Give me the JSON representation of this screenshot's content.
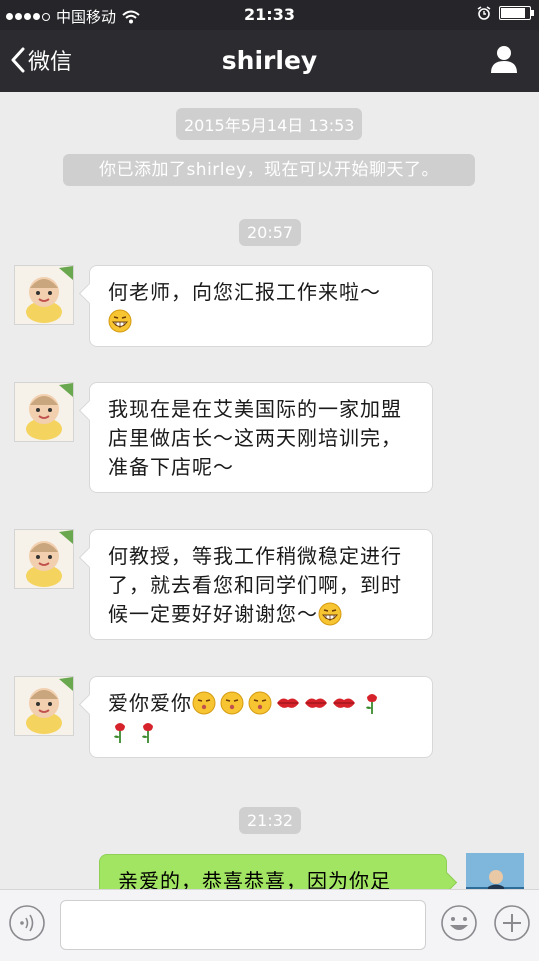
{
  "status_bar": {
    "carrier": "中国移动",
    "time": "21:33",
    "signal_bars_filled": 4,
    "signal_bars_total": 5,
    "battery_level": 0.85
  },
  "nav": {
    "back_label": "微信",
    "title": "shirley"
  },
  "chat": {
    "timestamps": [
      "2015年5月14日 13:53",
      "20:57",
      "21:32"
    ],
    "system_message": "你已添加了shirley，现在可以开始聊天了。",
    "messages": [
      {
        "text": "何老师，向您汇报工作来啦～",
        "emojis": [
          "grin-emoji"
        ]
      },
      {
        "text": "我现在是在艾美国际的一家加盟店里做店长～这两天刚培训完，准备下店呢～",
        "emojis": []
      },
      {
        "text": "何教授，等我工作稍微稳定进行了，就去看您和同学们啊，到时候一定要好好谢谢您～",
        "emojis": [
          "grin-emoji"
        ]
      },
      {
        "text": "爱你爱你",
        "emojis": [
          "kiss-face-emoji",
          "kiss-face-emoji",
          "kiss-face-emoji",
          "lips-emoji",
          "lips-emoji",
          "lips-emoji",
          "rose-emoji",
          "rose-emoji",
          "rose-emoji"
        ]
      }
    ],
    "outgoing_partial": "亲爱的，恭喜恭喜，因为你足"
  },
  "colors": {
    "nav_bg": "#2c2c30",
    "chat_bg": "#ececec",
    "outgoing_bubble": "#a2e563",
    "incoming_bubble": "#ffffff"
  }
}
